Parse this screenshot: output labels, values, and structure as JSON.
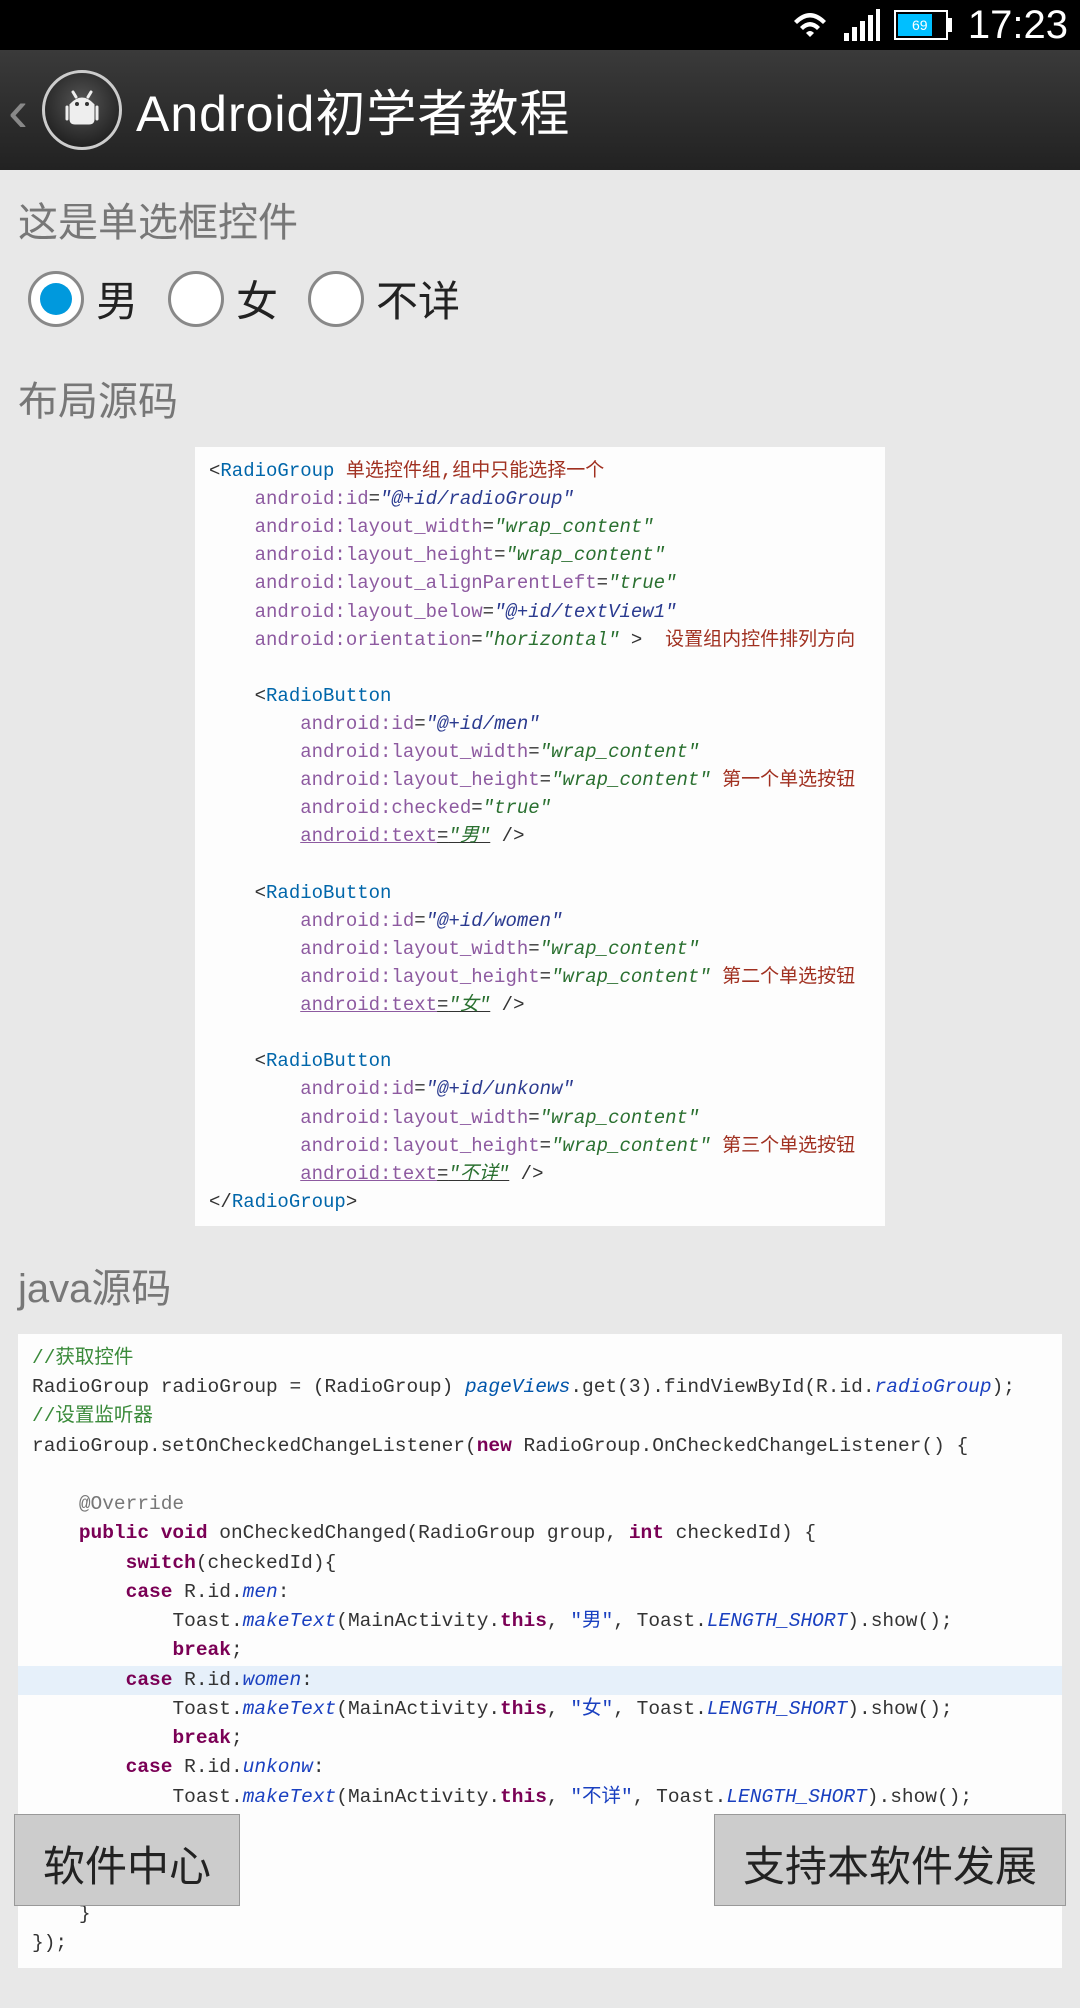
{
  "status": {
    "battery": "69",
    "time": "17:23"
  },
  "header": {
    "title": "Android初学者教程"
  },
  "section1": {
    "label": "这是单选框控件",
    "radios": [
      {
        "text": "男",
        "checked": true
      },
      {
        "text": "女",
        "checked": false
      },
      {
        "text": "不详",
        "checked": false
      }
    ]
  },
  "section2": {
    "label": "布局源码"
  },
  "section3": {
    "label": "java源码"
  },
  "xml": {
    "tag_rg": "RadioGroup",
    "tag_rb": "RadioButton",
    "attr_id": "android:id",
    "attr_w": "android:layout_width",
    "attr_h": "android:layout_height",
    "attr_apl": "android:layout_alignParentLeft",
    "attr_below": "android:layout_below",
    "attr_orient": "android:orientation",
    "attr_checked": "android:checked",
    "attr_text": "android:text",
    "v_rg": "\"@+id/radioGroup\"",
    "v_wc": "\"wrap_content\"",
    "v_true": "\"true\"",
    "v_tv1": "\"@+id/textView1\"",
    "v_horiz": "\"horizontal\"",
    "v_men": "\"@+id/men\"",
    "v_women": "\"@+id/women\"",
    "v_unkonw": "\"@+id/unkonw\"",
    "v_t1": "\"男\"",
    "v_t2": "\"女\"",
    "v_t3": "\"不详\"",
    "c1": "单选控件组,组中只能选择一个",
    "c2": "设置组内控件排列方向",
    "c3": "第一个单选按钮",
    "c4": "第二个单选按钮",
    "c5": "第三个单选按钮"
  },
  "java": {
    "c1": "//获取控件",
    "c2": "//设置监听器",
    "l1a": "RadioGroup radioGroup = (RadioGroup) ",
    "l1b": "pageViews",
    "l1c": ".get(3).findViewById(R.id.",
    "l1d": "radioGroup",
    "l1e": ");",
    "l2a": "radioGroup.setOnCheckedChangeListener(",
    "kw_new": "new",
    "l2b": " RadioGroup.OnCheckedChangeListener() {",
    "ann": "@Override",
    "kw_public": "public",
    "kw_void": "void",
    "m1": " onCheckedChanged(RadioGroup group, ",
    "kw_int": "int",
    "m2": " checkedId) {",
    "kw_switch": "switch",
    "sw": "(checkedId){",
    "kw_case": "case",
    "rid": " R.id.",
    "men": "men",
    "women": "women",
    "unkonw": "unkonw",
    "colon": ":",
    "toast1": "Toast.",
    "mt": "makeText",
    "toast2": "(MainActivity.",
    "kw_this": "this",
    "s1": "\"男\"",
    "s2": "\"女\"",
    "s3": "\"不详\"",
    "ls": "LENGTH_SHORT",
    "show": ").show();",
    "kw_break": "break",
    "semi": ";",
    "rb": "}",
    "end": "});",
    "comma": ", ",
    "toastc": ", Toast."
  },
  "footer": {
    "left": "软件中心",
    "right": "支持本软件发展"
  }
}
